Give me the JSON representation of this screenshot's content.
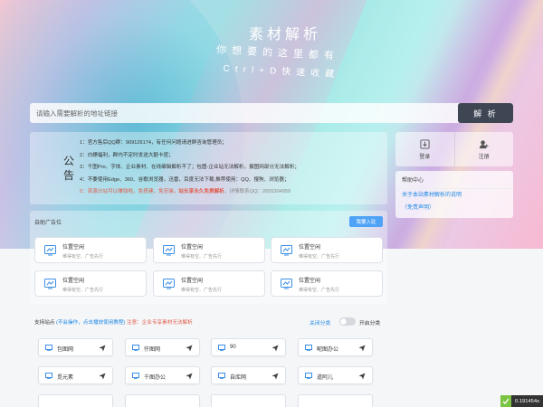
{
  "hero": {
    "title": "素材解析",
    "subtitle_1": "你想要的这里都有",
    "subtitle_2": "Ctrl+D快速收藏"
  },
  "search": {
    "placeholder": "请输入需要解析的地址链接",
    "button_label": "解 析"
  },
  "notice": {
    "label": "公告",
    "line_1": "1：官方售后QQ群：909126174，有任何问题请进群咨询管理员；",
    "line_2": "2：白嫖福利，群内不定时发送大额卡密；",
    "line_3": "3：千图Pro、字体、企业素材、在线编辑解析不了；包图-企业站无法解析，摄图网部分无法解析；",
    "line_4": "4：不要使用Edge、360、谷歌浏览器，迅雷，百度无法下载,推荐使用：QQ、搜狗、浏览器；",
    "line_5_a": "5：资源分站可以赚钱啦，免搭建，免安装，",
    "line_5_b": "站长享永久免费解析",
    "line_5_c": "，详情联系QQ：2655304959"
  },
  "user": {
    "login_label": "登录",
    "register_label": "注册"
  },
  "help": {
    "title": "帮助中心",
    "links": [
      "关于本站素材解析的说明",
      "（免责声明）"
    ]
  },
  "ads": {
    "title": "自助广告位",
    "buy_button": "我要入驻",
    "slots": [
      {
        "title": "位置空闲",
        "desc": "难得有空、广告先行"
      },
      {
        "title": "位置空闲",
        "desc": "难得有空、广告先行"
      },
      {
        "title": "位置空闲",
        "desc": "难得有空、广告先行"
      },
      {
        "title": "位置空闲",
        "desc": "难得有空、广告先行"
      },
      {
        "title": "位置空闲",
        "desc": "难得有空、广告先行"
      },
      {
        "title": "位置空闲",
        "desc": "难得有空、广告先行"
      }
    ]
  },
  "sites_bar": {
    "label": "支持站点",
    "hint": "(不会操作，点击播放使用教程)",
    "note": "注意：企业专享素材无法解析",
    "toggle_off": "关闭分类",
    "toggle_on": "开启分类"
  },
  "sites": [
    "包图网",
    "仟图网",
    "90",
    "昵图办公",
    "觅元素",
    "千图办公",
    "自库网",
    "道阿儿"
  ],
  "status": {
    "timer": "0.191454s"
  }
}
